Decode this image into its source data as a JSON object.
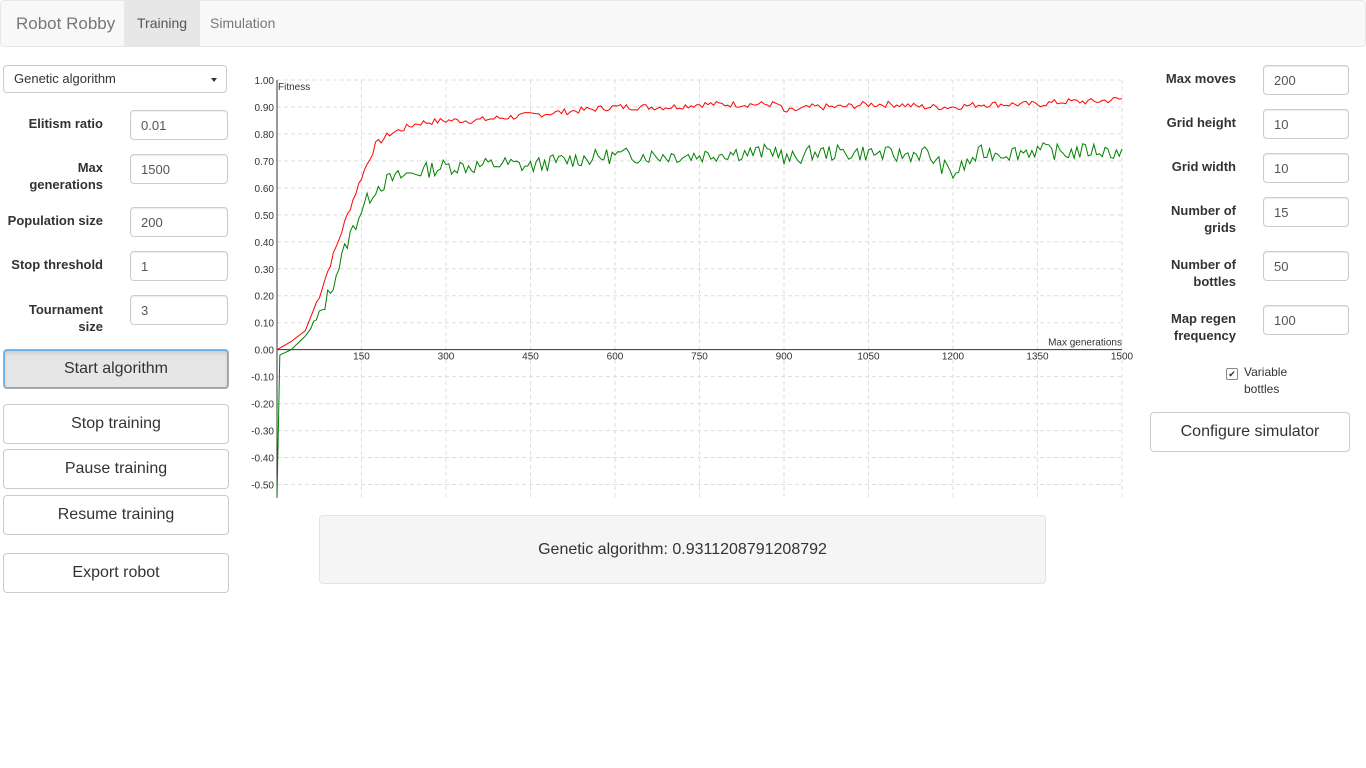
{
  "nav": {
    "brand": "Robot Robby",
    "tabs": [
      "Training",
      "Simulation"
    ]
  },
  "algorithm_select": "Genetic algorithm",
  "left_params": [
    {
      "label": "Elitism ratio",
      "value": "0.01"
    },
    {
      "label": "Max generations",
      "value": "1500"
    },
    {
      "label": "Population size",
      "value": "200"
    },
    {
      "label": "Stop threshold",
      "value": "1"
    },
    {
      "label": "Tournament size",
      "value": "3"
    }
  ],
  "buttons": {
    "start": "Start algorithm",
    "stop": "Stop training",
    "pause": "Pause training",
    "resume": "Resume training",
    "export": "Export robot",
    "configure": "Configure simulator"
  },
  "right_params": [
    {
      "label": "Max moves",
      "value": "200"
    },
    {
      "label": "Grid height",
      "value": "10"
    },
    {
      "label": "Grid width",
      "value": "10"
    },
    {
      "label": "Number of grids",
      "value": "15"
    },
    {
      "label": "Number of bottles",
      "value": "50"
    },
    {
      "label": "Map regen frequency",
      "value": "100"
    }
  ],
  "variable_bottles": {
    "label": "Variable bottles",
    "checked": true
  },
  "result_text": "Genetic algorithm: 0.9311208791208792",
  "colors": {
    "best": "#ff0000",
    "average": "#008000",
    "grid": "#dddddd"
  },
  "chart_data": {
    "type": "line",
    "ylabel": "Fitness",
    "xlabel": "Max generations",
    "xlim": [
      0,
      1500
    ],
    "ylim": [
      -0.55,
      1.0
    ],
    "xticks": [
      150,
      300,
      450,
      600,
      750,
      900,
      1050,
      1200,
      1350,
      1500
    ],
    "yticks": [
      1.0,
      0.9,
      0.8,
      0.7,
      0.6,
      0.5,
      0.4,
      0.3,
      0.2,
      0.1,
      0.0,
      -0.1,
      -0.2,
      -0.3,
      -0.4,
      -0.5
    ],
    "grid": true,
    "series": [
      {
        "color": "#ff0000",
        "x": [
          0,
          25,
          50,
          75,
          100,
          125,
          150,
          175,
          200,
          250,
          300,
          350,
          400,
          450,
          500,
          550,
          600,
          650,
          700,
          750,
          800,
          850,
          890,
          900,
          950,
          1000,
          1050,
          1100,
          1150,
          1200,
          1250,
          1300,
          1350,
          1400,
          1450,
          1500
        ],
        "y": [
          0.0,
          0.03,
          0.07,
          0.2,
          0.35,
          0.5,
          0.64,
          0.76,
          0.8,
          0.84,
          0.85,
          0.85,
          0.86,
          0.87,
          0.88,
          0.89,
          0.9,
          0.9,
          0.9,
          0.91,
          0.91,
          0.91,
          0.91,
          0.88,
          0.9,
          0.9,
          0.91,
          0.91,
          0.9,
          0.9,
          0.91,
          0.91,
          0.91,
          0.92,
          0.92,
          0.93
        ]
      },
      {
        "color": "#008000",
        "x": [
          0,
          5,
          25,
          50,
          75,
          100,
          125,
          150,
          175,
          200,
          250,
          300,
          350,
          400,
          450,
          500,
          550,
          600,
          650,
          700,
          750,
          800,
          850,
          890,
          900,
          950,
          1000,
          1050,
          1100,
          1150,
          1200,
          1250,
          1300,
          1350,
          1400,
          1450,
          1500
        ],
        "y": [
          -0.55,
          -0.02,
          0.0,
          0.05,
          0.12,
          0.25,
          0.4,
          0.52,
          0.6,
          0.63,
          0.66,
          0.68,
          0.68,
          0.69,
          0.68,
          0.7,
          0.71,
          0.72,
          0.72,
          0.72,
          0.72,
          0.73,
          0.73,
          0.74,
          0.7,
          0.73,
          0.73,
          0.73,
          0.72,
          0.73,
          0.65,
          0.73,
          0.73,
          0.74,
          0.73,
          0.74,
          0.73
        ]
      }
    ]
  }
}
